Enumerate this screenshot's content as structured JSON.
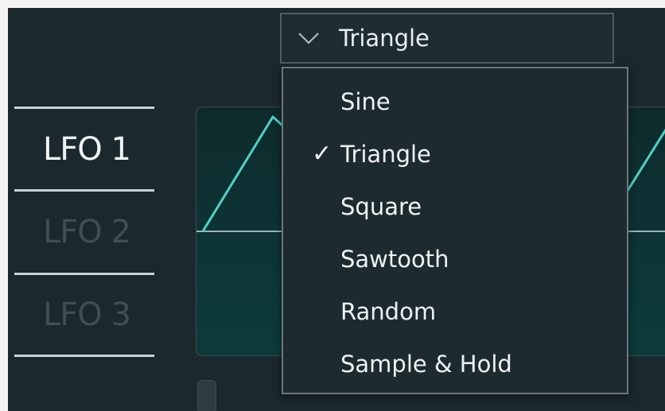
{
  "lfo_tabs": [
    {
      "label": "LFO 1",
      "active": true
    },
    {
      "label": "LFO 2",
      "active": false
    },
    {
      "label": "LFO 3",
      "active": false
    }
  ],
  "shape_selector": {
    "selected": "Triangle",
    "icon": "chevron-down-icon"
  },
  "shape_menu": {
    "items": [
      {
        "label": "Sine",
        "checked": false
      },
      {
        "label": "Triangle",
        "checked": true
      },
      {
        "label": "Square",
        "checked": false
      },
      {
        "label": "Sawtooth",
        "checked": false
      },
      {
        "label": "Random",
        "checked": false
      },
      {
        "label": "Sample & Hold",
        "checked": false
      }
    ],
    "check_glyph": "✓"
  },
  "colors": {
    "panel_bg": "#1b282d",
    "wave_stroke": "#4fd1c5",
    "active_text": "#eef2f3",
    "inactive_text": "#3f4e52"
  }
}
